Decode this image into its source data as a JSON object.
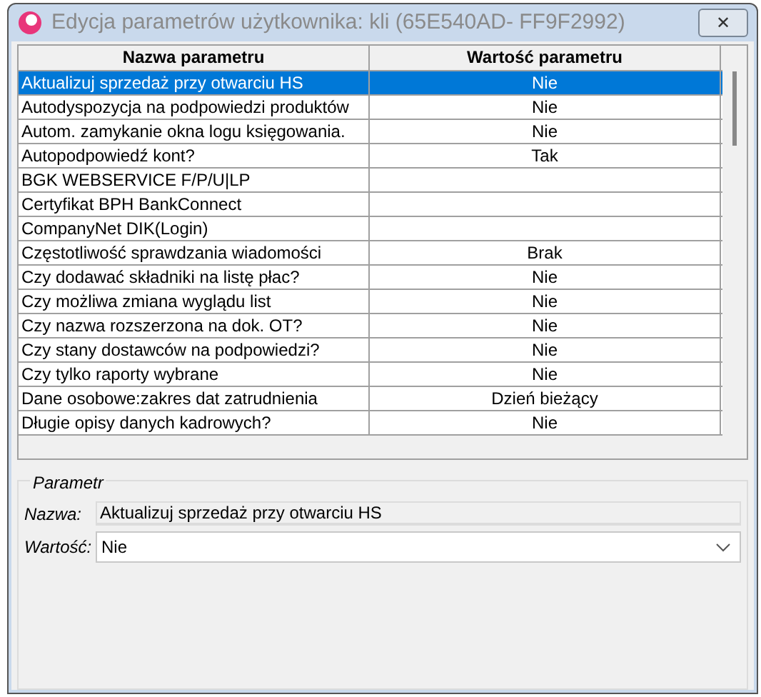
{
  "window": {
    "title": "Edycja parametrów użytkownika: kli (65E540AD- FF9F2992)",
    "close": "✕"
  },
  "table": {
    "columns": [
      "Nazwa parametru",
      "Wartość parametru"
    ],
    "rows": [
      {
        "name": "Aktualizuj sprzedaż przy otwarciu HS",
        "value": "Nie",
        "selected": true
      },
      {
        "name": "Autodyspozycja na podpowiedzi produktów",
        "value": "Nie",
        "selected": false
      },
      {
        "name": "Autom. zamykanie okna logu księgowania.",
        "value": "Nie",
        "selected": false
      },
      {
        "name": "Autopodpowiedź kont?",
        "value": "Tak",
        "selected": false
      },
      {
        "name": "BGK WEBSERVICE F/P/U|LP",
        "value": "",
        "selected": false
      },
      {
        "name": "Certyfikat BPH BankConnect",
        "value": "",
        "selected": false
      },
      {
        "name": "CompanyNet DIK(Login)",
        "value": "",
        "selected": false
      },
      {
        "name": "Częstotliwość sprawdzania wiadomości",
        "value": "Brak",
        "selected": false
      },
      {
        "name": "Czy dodawać składniki na listę płac?",
        "value": "Nie",
        "selected": false
      },
      {
        "name": "Czy możliwa zmiana wyglądu list",
        "value": "Nie",
        "selected": false
      },
      {
        "name": "Czy nazwa rozszerzona na dok. OT?",
        "value": "Nie",
        "selected": false
      },
      {
        "name": "Czy stany dostawców na podpowiedzi?",
        "value": "Nie",
        "selected": false
      },
      {
        "name": "Czy tylko raporty wybrane",
        "value": "Nie",
        "selected": false
      },
      {
        "name": "Dane osobowe:zakres dat zatrudnienia",
        "value": "Dzień bieżący",
        "selected": false
      },
      {
        "name": "Długie opisy danych kadrowych?",
        "value": "Nie",
        "selected": false
      }
    ]
  },
  "parameter": {
    "title": "Parametr",
    "name_label": "Nazwa:",
    "name_value": "Aktualizuj sprzedaż przy otwarciu HS",
    "value_label": "Wartość:",
    "value": "Nie"
  }
}
